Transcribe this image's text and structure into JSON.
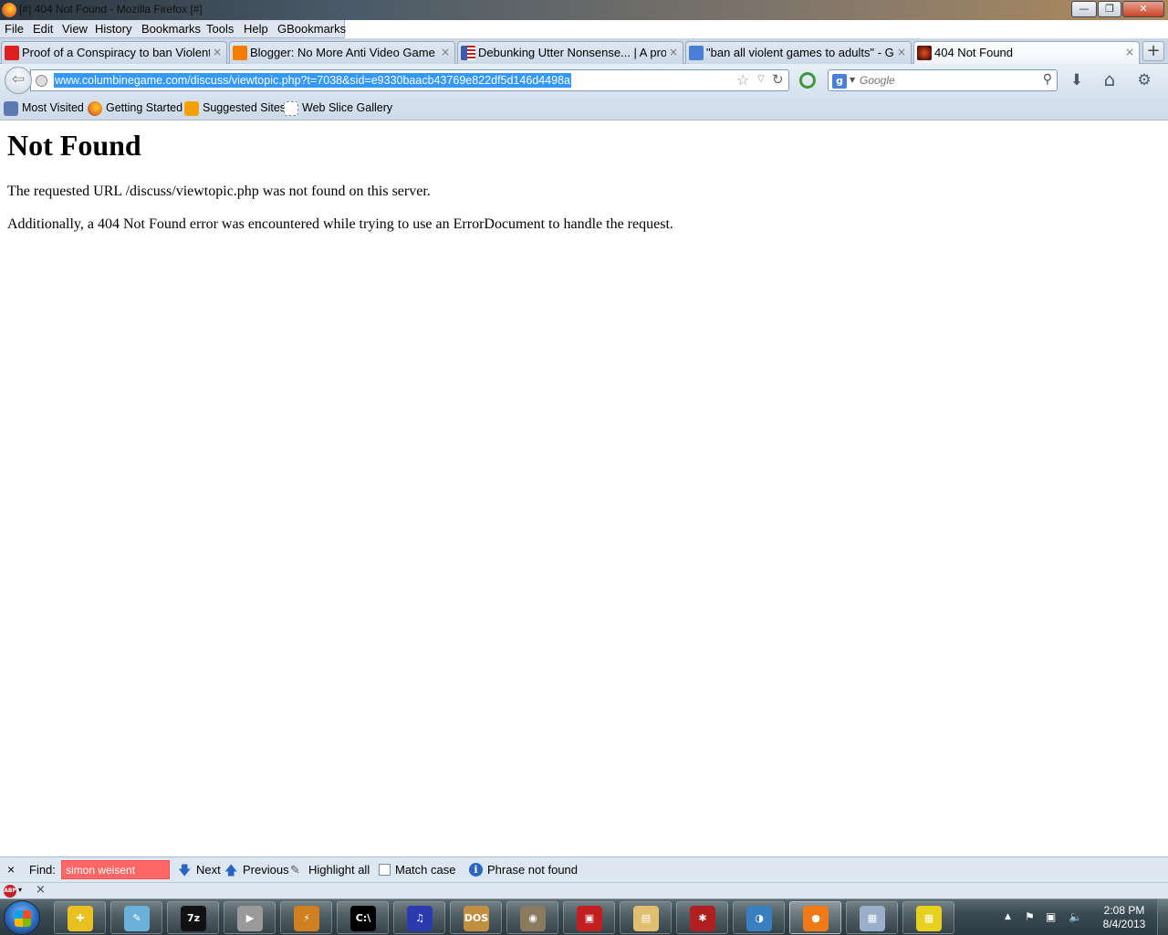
{
  "window": {
    "title": "[#] 404 Not Found - Mozilla Firefox [#]",
    "minimize_glyph": "—",
    "maximize_glyph": "❐",
    "close_glyph": "✕"
  },
  "menu": [
    "File",
    "Edit",
    "View",
    "History",
    "Bookmarks",
    "Tools",
    "Help",
    "GBookmarks"
  ],
  "tabs": [
    {
      "label": "Proof of a Conspiracy to ban Violent ...",
      "icon": "youtube-icon",
      "color": "#e02020",
      "active": false
    },
    {
      "label": "Blogger: No More Anti Video Game B...",
      "icon": "blogger-icon",
      "color": "#f57d00",
      "active": false
    },
    {
      "label": "Debunking Utter Nonsense... | A pro v...",
      "icon": "us-flag-icon",
      "color": "#3a5ab0",
      "active": false
    },
    {
      "label": "\"ban all violent games to adults\" - Go...",
      "icon": "google-icon",
      "color": "#4a7fd6",
      "active": false
    },
    {
      "label": "404 Not Found",
      "icon": "site-favicon-icon",
      "color": "#a02010",
      "active": true
    }
  ],
  "tab_close_glyph": "×",
  "newtab_glyph": "+",
  "navbar": {
    "url": "www.columbinegame.com/discuss/viewtopic.php?t=7038&sid=e9330baacb43769e822df5d146d4498a",
    "search_placeholder": "Google",
    "back_glyph": "⇦",
    "star_glyph": "☆",
    "dropdown_glyph": "▽",
    "reload_glyph": "↻",
    "search_glyph": "⚲",
    "download_glyph": "⬇",
    "home_glyph": "⌂",
    "addon_glyph": "⚙"
  },
  "bookmarks": [
    {
      "label": "Most Visited",
      "icon": "most-visited-icon",
      "color": "#5a7ab0"
    },
    {
      "label": "Getting Started",
      "icon": "firefox-icon",
      "color": "#f07a1a"
    },
    {
      "label": "Suggested Sites",
      "icon": "suggested-sites-icon",
      "color": "#f5a000"
    },
    {
      "label": "Web Slice Gallery",
      "icon": "web-slice-icon",
      "color": "#ffffff"
    }
  ],
  "page": {
    "heading": "Not Found",
    "para1": "The requested URL /discuss/viewtopic.php was not found on this server.",
    "para2": "Additionally, a 404 Not Found error was encountered while trying to use an ErrorDocument to handle the request."
  },
  "findbar": {
    "close_glyph": "×",
    "label": "Find:",
    "query": "simon weisent",
    "next": "Next",
    "previous": "Previous",
    "highlight_all": "Highlight all",
    "match_case": "Match case",
    "status": "Phrase not found",
    "next_glyph": "🡇",
    "prev_glyph": "🡅",
    "highlight_glyph": "✎",
    "info_glyph": "i"
  },
  "addonbar": {
    "abp_label": "ABP",
    "dropdown_glyph": "▾",
    "close_glyph": "×"
  },
  "taskbar": {
    "apps": [
      {
        "name": "taskbar-app-kerio",
        "glyph": "✚",
        "color": "#e8c020"
      },
      {
        "name": "taskbar-app-notepad",
        "glyph": "✎",
        "color": "#6ab0d8"
      },
      {
        "name": "taskbar-app-7zip",
        "glyph": "7z",
        "color": "#111111"
      },
      {
        "name": "taskbar-app-media",
        "glyph": "▶",
        "color": "#9a9a9a"
      },
      {
        "name": "taskbar-app-winamp",
        "glyph": "⚡",
        "color": "#d08020"
      },
      {
        "name": "taskbar-app-cmd",
        "glyph": "C:\\",
        "color": "#000000"
      },
      {
        "name": "taskbar-app-audacity",
        "glyph": "♫",
        "color": "#2a3ab0"
      },
      {
        "name": "taskbar-app-dosbox",
        "glyph": "DOS",
        "color": "#c09040"
      },
      {
        "name": "taskbar-app-gimp",
        "glyph": "◉",
        "color": "#8a7a60"
      },
      {
        "name": "taskbar-app-video-editor",
        "glyph": "▣",
        "color": "#c02020"
      },
      {
        "name": "taskbar-app-explorer",
        "glyph": "▤",
        "color": "#e0c070"
      },
      {
        "name": "taskbar-app-spider",
        "glyph": "✱",
        "color": "#b02020"
      },
      {
        "name": "taskbar-app-openoffice",
        "glyph": "◑",
        "color": "#3a80c0"
      },
      {
        "name": "taskbar-app-firefox",
        "glyph": "●",
        "color": "#f07a1a"
      },
      {
        "name": "taskbar-app-calculator",
        "glyph": "▦",
        "color": "#9ab0c8"
      },
      {
        "name": "taskbar-app-calculator2",
        "glyph": "▦",
        "color": "#e8d020"
      }
    ],
    "tray_up_glyph": "▲",
    "tray_flag_glyph": "⚑",
    "tray_network_glyph": "▣",
    "tray_volume_glyph": "🔈",
    "time": "2:08 PM",
    "date": "8/4/2013"
  }
}
